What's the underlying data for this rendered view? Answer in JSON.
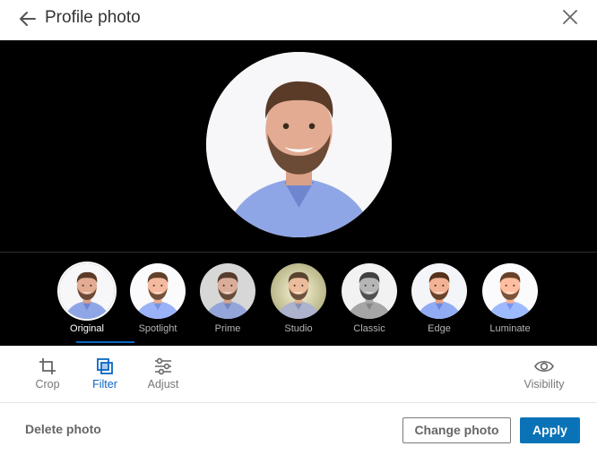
{
  "header": {
    "title": "Profile photo",
    "back_icon": "arrow-left-icon",
    "close_icon": "close-icon"
  },
  "photo": {
    "subject": "profile-photo",
    "background_color": "#f7f7f9"
  },
  "filters": {
    "items": [
      {
        "label": "Original",
        "selected": true
      },
      {
        "label": "Spotlight",
        "selected": false
      },
      {
        "label": "Prime",
        "selected": false
      },
      {
        "label": "Studio",
        "selected": false
      },
      {
        "label": "Classic",
        "selected": false
      },
      {
        "label": "Edge",
        "selected": false
      },
      {
        "label": "Luminate",
        "selected": false
      }
    ]
  },
  "toolbar": {
    "crop": {
      "label": "Crop",
      "icon": "crop-icon"
    },
    "filter": {
      "label": "Filter",
      "icon": "filter-icon",
      "active": true
    },
    "adjust": {
      "label": "Adjust",
      "icon": "sliders-icon"
    },
    "visibility": {
      "label": "Visibility",
      "icon": "eye-icon"
    }
  },
  "footer": {
    "delete_label": "Delete photo",
    "change_label": "Change photo",
    "apply_label": "Apply"
  },
  "colors": {
    "accent": "#0a66c2",
    "apply_button": "#0a73b7",
    "stage_background": "#000000"
  }
}
